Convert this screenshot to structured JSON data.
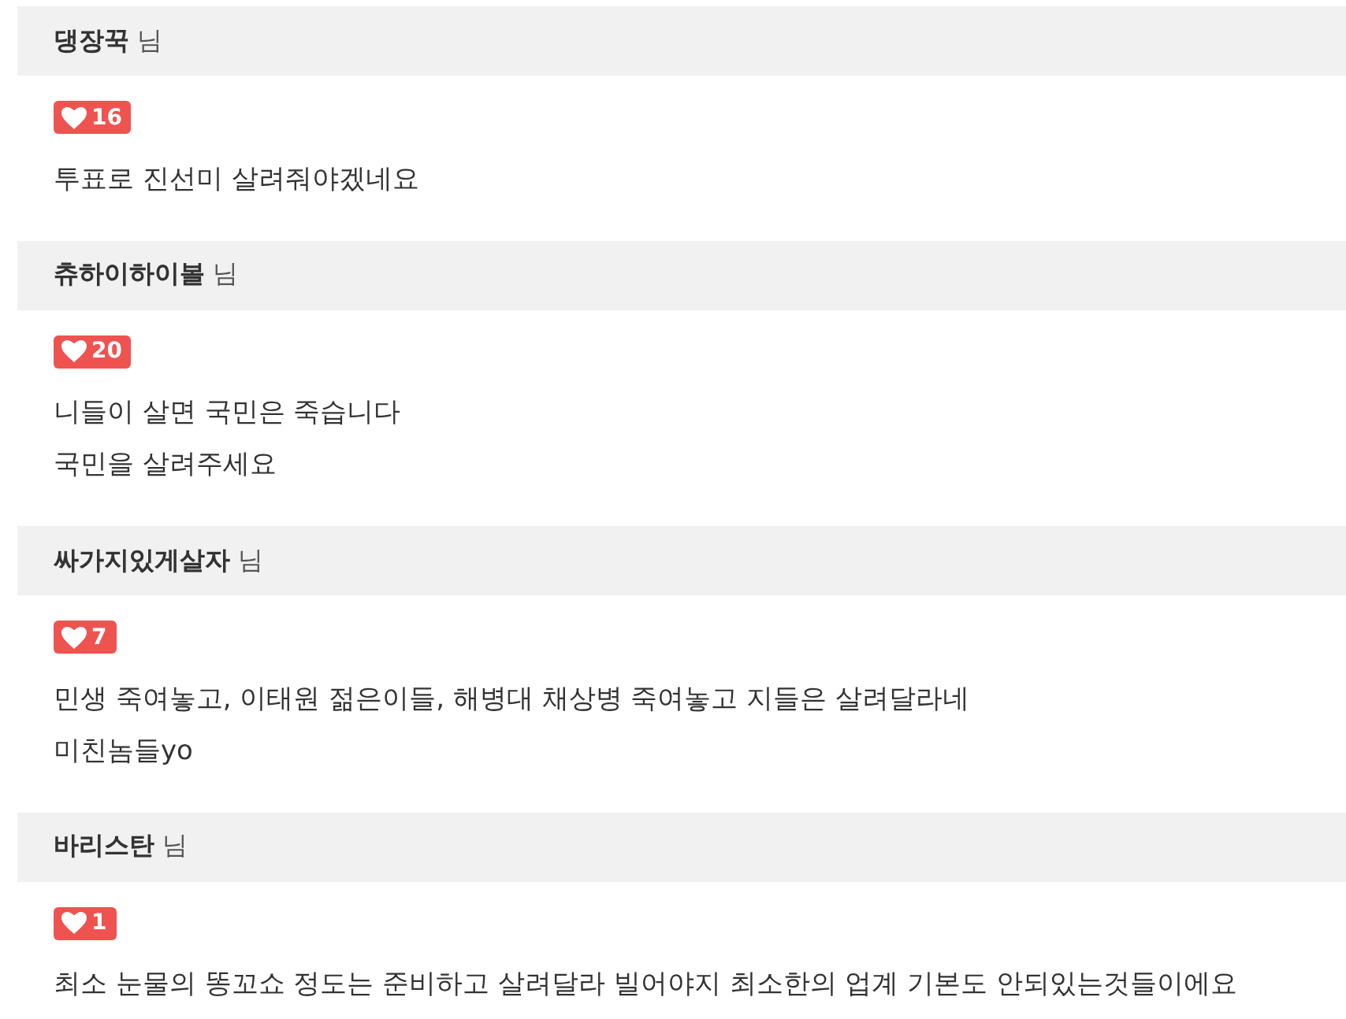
{
  "comments": [
    {
      "author": "댕장꾹",
      "suffix": "님",
      "likes": "16",
      "lines": [
        "투표로 진선미 살려줘야겠네요"
      ]
    },
    {
      "author": "츄하이하이볼",
      "suffix": "님",
      "likes": "20",
      "lines": [
        "니들이 살면 국민은 죽습니다",
        "국민을 살려주세요"
      ]
    },
    {
      "author": "싸가지있게살자",
      "suffix": "님",
      "likes": "7",
      "lines": [
        "민생 죽여놓고, 이태원 젊은이들, 해병대 채상병 죽여놓고 지들은 살려달라네",
        "미친놈들yo"
      ]
    },
    {
      "author": "바리스탄",
      "suffix": "님",
      "likes": "1",
      "lines": [
        "최소 눈물의 똥꼬쇼 정도는 준비하고 살려달라 빌어야지 최소한의 업계 기본도 안되있는것들이에요"
      ]
    }
  ]
}
